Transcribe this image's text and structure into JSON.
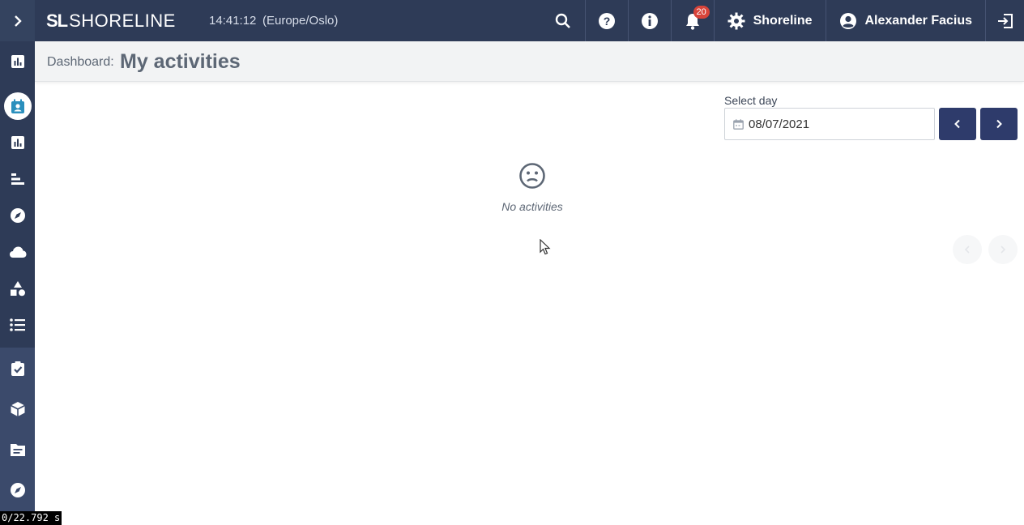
{
  "topbar": {
    "logo_mark": "SL",
    "logo_text": "SHORELINE",
    "clock": "14:41:12",
    "timezone": "(Europe/Oslo)",
    "notifications_count": "20",
    "settings_label": "Shoreline",
    "user_name": "Alexander Facius"
  },
  "sidebar": {
    "items": [
      {
        "icon": "dashboard-chart-icon"
      },
      {
        "icon": "user-calendar-icon",
        "active": true
      },
      {
        "icon": "bar-chart-icon"
      },
      {
        "icon": "gantt-icon"
      },
      {
        "icon": "compass-icon"
      },
      {
        "icon": "cloud-icon"
      },
      {
        "icon": "shapes-icon"
      },
      {
        "icon": "list-icon"
      },
      {
        "icon": "checklist-icon"
      },
      {
        "icon": "package-icon"
      },
      {
        "icon": "folder-icon"
      },
      {
        "icon": "compass-icon"
      }
    ]
  },
  "header": {
    "breadcrumb_label": "Dashboard:",
    "title": "My activities"
  },
  "day_picker": {
    "label": "Select day",
    "value": "08/07/2021"
  },
  "empty_state": {
    "message": "No activities"
  },
  "overlay": {
    "timer": "0/22.792 s"
  },
  "colors": {
    "topbar": "#2e3b57",
    "accent": "#2e3b6b",
    "active_icon": "#2a8fbd",
    "badge": "#d8443a"
  }
}
